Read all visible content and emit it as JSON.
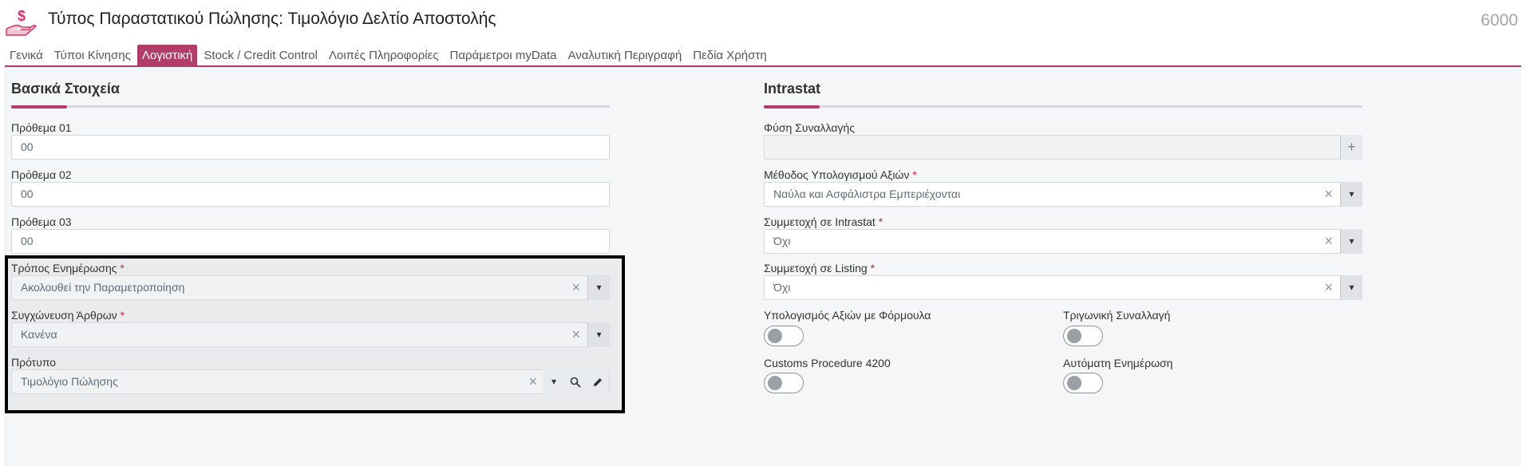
{
  "header": {
    "title": "Τύπος Παραστατικού Πώλησης: Τιμολόγιο Δελτίο Αποστολής",
    "code": "6000",
    "icon": "hand-dollar-icon",
    "icon_color": "#d6336c"
  },
  "tabs": [
    {
      "label": "Γενικά"
    },
    {
      "label": "Τύποι Κίνησης"
    },
    {
      "label": "Λογιστική",
      "active": true
    },
    {
      "label": "Stock / Credit Control"
    },
    {
      "label": "Λοιπές Πληροφορίες"
    },
    {
      "label": "Παράμετροι myData"
    },
    {
      "label": "Αναλυτική Περιγραφή"
    },
    {
      "label": "Πεδία Χρήστη"
    }
  ],
  "accent_color": "#b23d6a",
  "left": {
    "title": "Βασικά Στοιχεία",
    "prefix1": {
      "label": "Πρόθεμα 01",
      "value": "00"
    },
    "prefix2": {
      "label": "Πρόθεμα 02",
      "value": "00"
    },
    "prefix3": {
      "label": "Πρόθεμα 03",
      "value": "00"
    },
    "update_mode": {
      "label": "Τρόπος Ενημέρωσης",
      "required": "*",
      "value": "Ακολουθεί την Παραμετροποίηση"
    },
    "merge_items": {
      "label": "Συγχώνευση Άρθρων",
      "required": "*",
      "value": "Κανένα"
    },
    "template": {
      "label": "Πρότυπο",
      "value": "Τιμολόγιο Πώλησης"
    }
  },
  "right": {
    "title": "Intrastat",
    "transaction_nature": {
      "label": "Φύση Συναλλαγής",
      "value": ""
    },
    "value_method": {
      "label": "Μέθοδος Υπολογισμού Αξιών",
      "required": "*",
      "value": "Ναύλα και Ασφάλιστρα Εμπεριέχονται"
    },
    "intrastat_participation": {
      "label": "Συμμετοχή σε Intrastat",
      "required": "*",
      "value": "Όχι"
    },
    "listing_participation": {
      "label": "Συμμετοχή σε Listing",
      "required": "*",
      "value": "Όχι"
    },
    "formula_calc": {
      "label": "Υπολογισμός Αξιών με Φόρμουλα"
    },
    "triangular": {
      "label": "Τριγωνική Συναλλαγή"
    },
    "customs_procedure": {
      "label": "Customs Procedure 4200"
    },
    "auto_update": {
      "label": "Αυτόματη Ενημέρωση"
    }
  },
  "glyphs": {
    "clear": "×",
    "caret": "▾",
    "plus": "+"
  }
}
